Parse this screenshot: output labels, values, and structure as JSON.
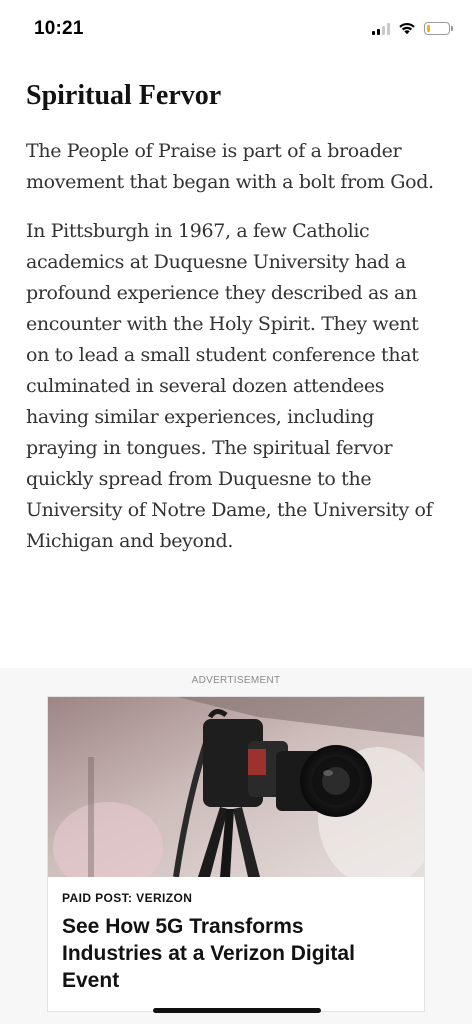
{
  "status_bar": {
    "time": "10:21",
    "signal_bars": 4,
    "signal_bars_active": 2,
    "battery_level": 0.15,
    "battery_color": "#f5b800"
  },
  "article": {
    "heading": "Spiritual Fervor",
    "paragraphs": [
      "The People of Praise is part of a broader movement that began with a bolt from God.",
      "In Pittsburgh in 1967, a few Catholic academics at Duquesne University had a profound experience they described as an encounter with the Holy Spirit. They went on to lead a small student conference that culminated in several dozen attendees having similar experiences, including praying in tongues. The spiritual fervor quickly spread from Duquesne to the University of Notre Dame, the University of Michigan and beyond."
    ]
  },
  "ad": {
    "label": "ADVERTISEMENT",
    "sponsor": "PAID POST: VERIZON",
    "title": "See How 5G Transforms Industries at a Verizon Digital Event",
    "image_subject": "camera-on-tripod"
  }
}
